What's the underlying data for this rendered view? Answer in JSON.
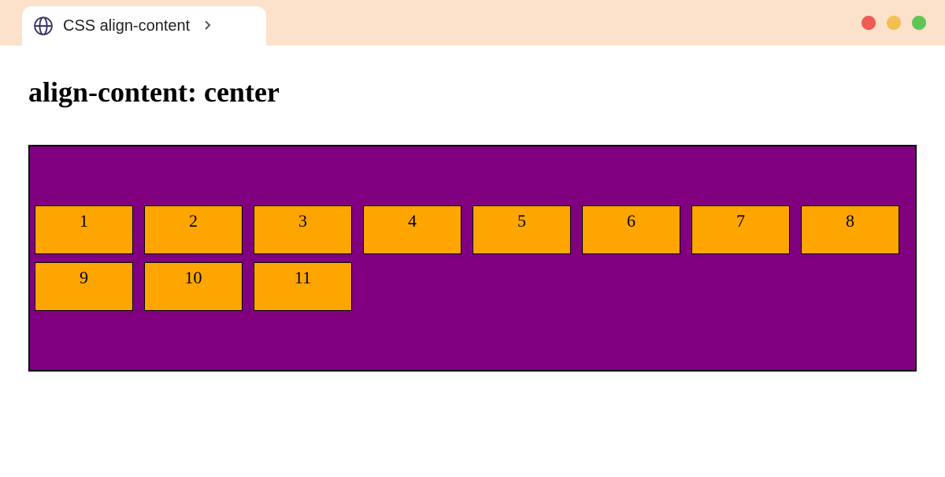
{
  "tab": {
    "title": "CSS align-content"
  },
  "heading": "align-content: center",
  "items": {
    "0": "1",
    "1": "2",
    "2": "3",
    "3": "4",
    "4": "5",
    "5": "6",
    "6": "7",
    "7": "8",
    "8": "9",
    "9": "10",
    "10": "11"
  },
  "colors": {
    "container_bg": "#800080",
    "item_bg": "#ffa500",
    "title_bar_bg": "#fce1cb"
  }
}
